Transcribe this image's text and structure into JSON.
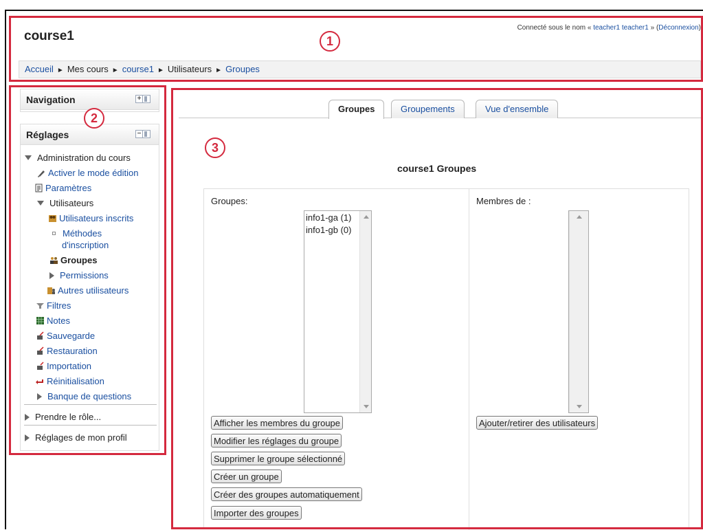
{
  "header": {
    "course_title": "course1",
    "login_prefix": "Connecté sous le nom « ",
    "login_user": "teacher1 teacher1",
    "login_mid": " » (",
    "logout_label": "Déconnexion",
    "login_suffix": ")"
  },
  "breadcrumb": {
    "items": [
      "Accueil",
      "Mes cours",
      "course1",
      "Utilisateurs",
      "Groupes"
    ],
    "separator": "►"
  },
  "annotations": [
    "1",
    "2",
    "3"
  ],
  "navigation_block": {
    "title": "Navigation",
    "control": "+"
  },
  "settings_block": {
    "title": "Réglages",
    "control": "−",
    "tree": [
      "Administration du cours",
      "Activer le mode édition",
      "Paramètres",
      "Utilisateurs",
      "Utilisateurs inscrits",
      "Méthodes",
      "d'inscription",
      "Groupes",
      "Permissions",
      "Autres utilisateurs",
      "Filtres",
      "Notes",
      "Sauvegarde",
      "Restauration",
      "Importation",
      "Réinitialisation",
      "Banque de questions",
      "Prendre le rôle...",
      "Réglages de mon profil"
    ]
  },
  "tabs": [
    {
      "label": "Groupes",
      "active": true
    },
    {
      "label": "Groupements",
      "active": false
    },
    {
      "label": "Vue d'ensemble",
      "active": false
    }
  ],
  "main": {
    "title": "course1 Groupes",
    "groups_label": "Groupes:",
    "members_label": "Membres de :",
    "groups_list": [
      "info1-ga (1)",
      "info1-gb (0)"
    ],
    "group_buttons": [
      "Afficher les membres du groupe",
      "Modifier les réglages du groupe",
      "Supprimer le groupe sélectionné",
      "Créer un groupe",
      "Créer des groupes automatiquement",
      "Importer des groupes"
    ],
    "members_button": "Ajouter/retirer des utilisateurs"
  },
  "colors": {
    "annotation": "#d4293e",
    "link": "#1a4fa0"
  }
}
